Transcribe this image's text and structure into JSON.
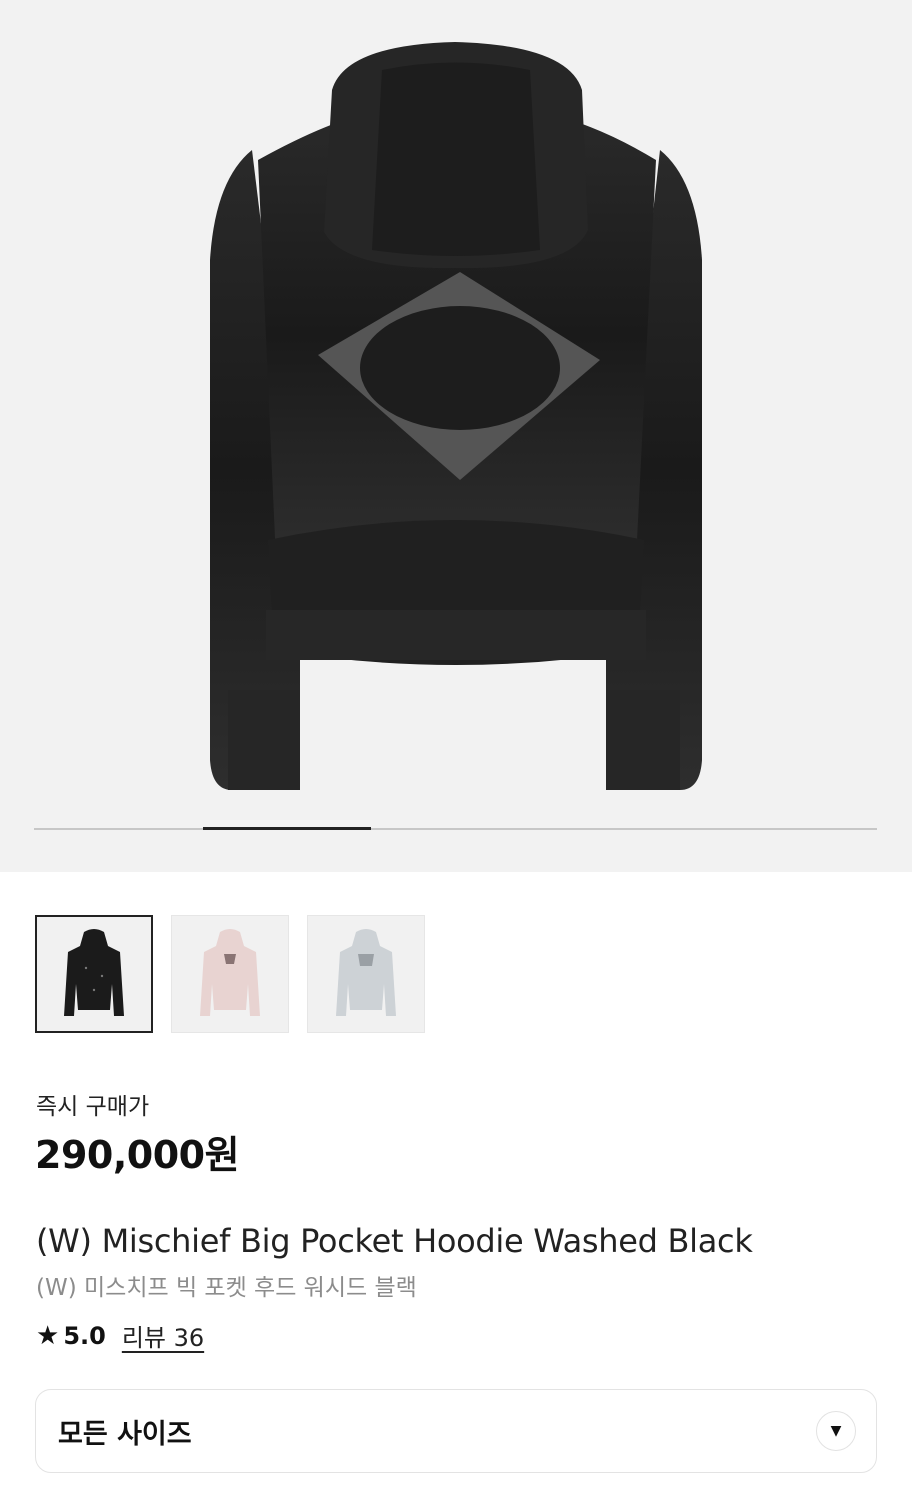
{
  "gallery": {
    "main_image": "black-hoodie-back-view",
    "thumbnails": [
      {
        "name": "black-hoodie-thumbnail",
        "color": "#1b1b1b",
        "selected": true
      },
      {
        "name": "pink-hoodie-thumbnail",
        "color": "#e8d3d1",
        "selected": false
      },
      {
        "name": "grey-hoodie-thumbnail",
        "color": "#cdd2d6",
        "selected": false
      }
    ],
    "slide_progress": 0.2
  },
  "product": {
    "price_label": "즉시 구매가",
    "price": "290,000원",
    "title_en": "(W) Mischief Big Pocket Hoodie Washed Black",
    "title_ko": "(W) 미스치프 빅 포켓 후드 워시드 블랙",
    "rating": "5.0",
    "review_label": "리뷰 36"
  },
  "size_select": {
    "label": "모든 사이즈",
    "icon": "chevron-down-icon"
  }
}
